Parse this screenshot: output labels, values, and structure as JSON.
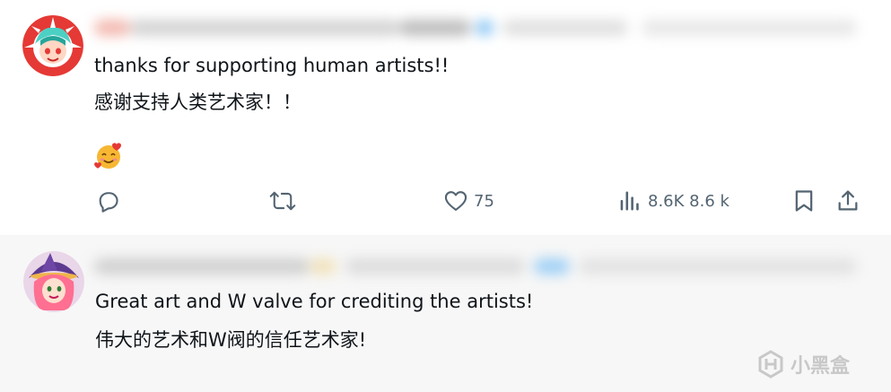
{
  "posts": [
    {
      "lines": [
        "thanks for supporting human artists!!",
        "感谢支持人类艺术家！！"
      ],
      "emoji_name": "smiling-face-with-hearts-icon",
      "actions": {
        "reply_count": "",
        "repost_count": "",
        "like_count": "75",
        "views_count": "8.6K 8.6 k"
      }
    },
    {
      "lines": [
        "Great art and W valve for crediting the artists!",
        "伟大的艺术和W阀的信任艺术家!"
      ]
    }
  ],
  "watermark": {
    "text": "小黑盒"
  },
  "colors": {
    "icon": "#536471",
    "text": "#0f1419",
    "reply_bg": "#f7f7f7"
  }
}
